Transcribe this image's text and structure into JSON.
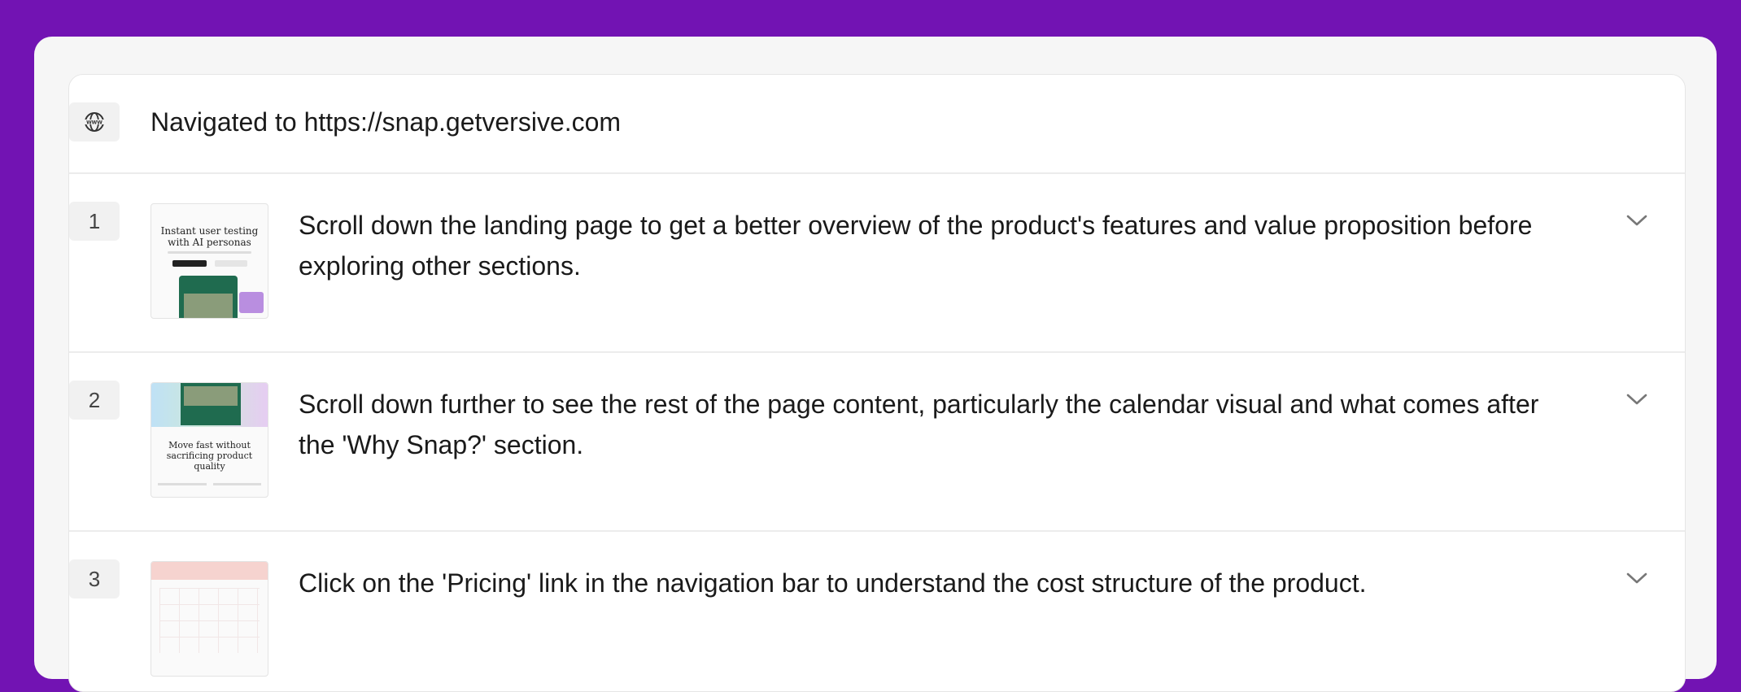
{
  "navigation": {
    "icon": "globe-icon",
    "text": "Navigated to https://snap.getversive.com"
  },
  "steps": [
    {
      "number": "1",
      "thumbnail_heading": "Instant user testing with AI personas",
      "text": "Scroll down the landing page to get a better overview of the product's features and value proposition before exploring other sections."
    },
    {
      "number": "2",
      "thumbnail_heading": "Move fast without sacrificing product quality",
      "text": "Scroll down further to see the rest of the page content, particularly the calendar visual and what comes after the 'Why Snap?' section."
    },
    {
      "number": "3",
      "thumbnail_heading": "",
      "text": "Click on the 'Pricing' link in the navigation bar to understand the cost structure of the product."
    }
  ],
  "colors": {
    "background": "#7213b3",
    "card": "#f6f6f6",
    "panel": "#ffffff",
    "thumbnail_green": "#1f6b4f"
  }
}
